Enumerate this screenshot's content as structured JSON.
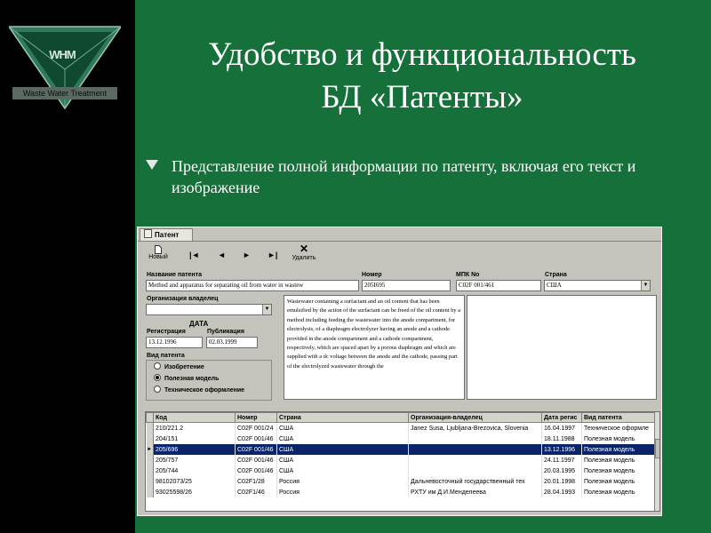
{
  "sidebar": {
    "logo_text": "WHM",
    "logo_caption": "Waste Water Treatment"
  },
  "slide": {
    "title_line1": "Удобство и функциональность",
    "title_line2": "БД «Патенты»",
    "bullet_text": "Представление полной информации по патенту, включая его текст и изображение"
  },
  "app": {
    "tab_label": "Патент",
    "toolbar": {
      "new_label": "Новый",
      "first_glyph": "|◄",
      "prev_glyph": "◄",
      "next_glyph": "►",
      "last_glyph": "►|",
      "delete_glyph": "✕",
      "delete_label": "Удалить"
    },
    "form": {
      "title_label": "Название патента",
      "title_value": "Method and apparatus for separating oil from water in wastew",
      "number_label": "Номер",
      "number_value": "205I695",
      "ipc_label": "МПК No",
      "ipc_value": "C02F 001/461",
      "country_label": "Страна",
      "country_value": "США",
      "owner_label": "Организация владелец",
      "owner_value": "",
      "date_group_label": "ДАТА",
      "registration_label": "Регистрация",
      "registration_value": "13.12.1996",
      "publication_label": "Публикация",
      "publication_value": "02.03.1999",
      "type_label": "Вид патента",
      "type_options": [
        "Изобретение",
        "Полезная модель",
        "Техническое оформление"
      ],
      "type_selected": "Полезная модель",
      "abstract": "Wastewater containing a surfactant and an oil content that has been emulsified by the action of the surfactant can be freed of the oil content by a method including feeding the wastewater into the anode compartment, for electrolysis, of a diaphragm electrolyzer having an anode and a cathode provided in the anode compartment and a cathode compartment, respectively, which are spaced apart by a porous diaphragm and which are supplied with a dc voltage between the anode and the cathode, passing part of the electrolyzed wastewater through the"
    },
    "grid": {
      "columns": [
        "Код",
        "Номер",
        "Страна",
        "Организация-владелец",
        "Дата регис",
        "Вид патента"
      ],
      "rows": [
        [
          "210/221.2",
          "C02F 001/24",
          "США",
          "Janez Susa, Ljubljana-Brezovica, Slovenia",
          "16.04.1997",
          "Техническое оформле"
        ],
        [
          "204/151",
          "C02F 001/46",
          "США",
          "",
          "18.11.1988",
          "Полезная модель"
        ],
        [
          "205/696",
          "C02F 001/46",
          "США",
          "",
          "13.12.1996",
          "Полезная модель"
        ],
        [
          "205/757",
          "C02F 001/46",
          "США",
          "",
          "24.11.1997",
          "Полезная модель"
        ],
        [
          "205/744",
          "C02F 001/46",
          "США",
          "",
          "20.03.1995",
          "Полезная модель"
        ],
        [
          "98102073/25",
          "C02F1/28",
          "Россия",
          "Дальневосточный государственный тех",
          "20.01.1998",
          "Полезная модель"
        ],
        [
          "93025598/26",
          "C02F1/46",
          "Россия",
          "РХТУ им Д.И.Менделеева",
          "28.04.1993",
          "Полезная модель"
        ]
      ],
      "selected_row": 2
    }
  }
}
